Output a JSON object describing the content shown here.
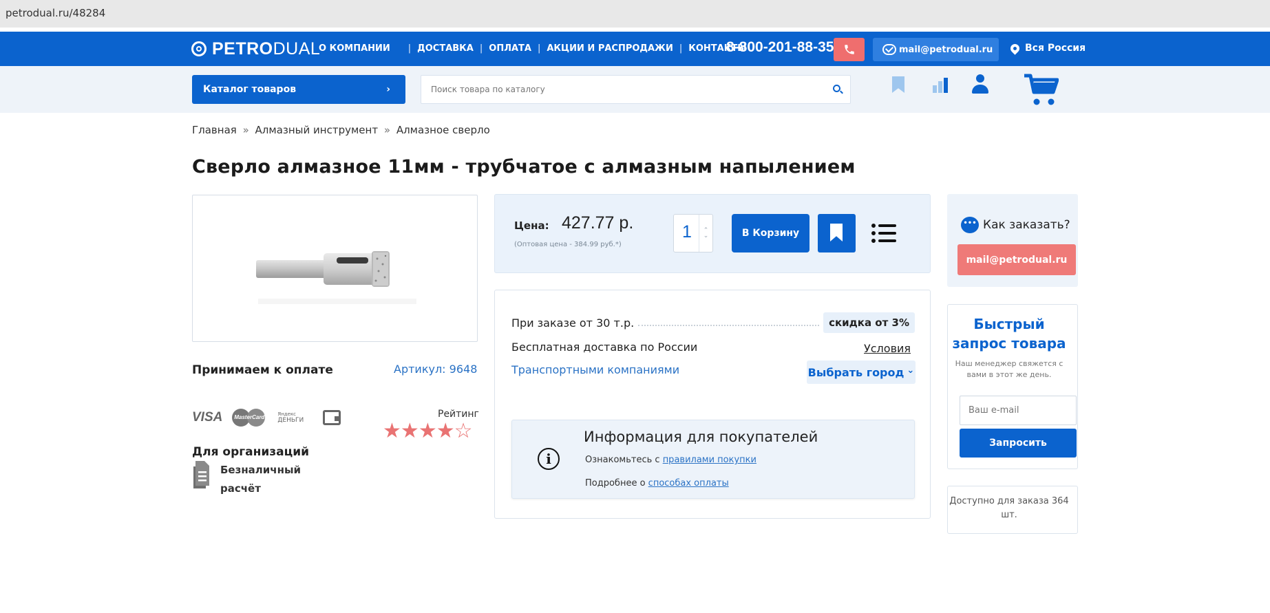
{
  "browser": {
    "url": "petrodual.ru/48284"
  },
  "header": {
    "logo_bold": "PETRO",
    "logo_light": "DUAL",
    "nav": [
      "О КОМПАНИИ",
      "ДОСТАВКА",
      "ОПЛАТА",
      "АКЦИИ И РАСПРОДАЖИ",
      "КОНТАКТЫ"
    ],
    "phone": "8-800-201-88-35",
    "email": "mail@petrodual.ru",
    "region": "Вся Россия"
  },
  "subbar": {
    "catalog_label": "Каталог товаров",
    "catalog_arrow": "›",
    "search_placeholder": "Поиск товара по каталогу"
  },
  "breadcrumb": {
    "items": [
      "Главная",
      "Алмазный инструмент",
      "Алмазное сверло"
    ],
    "separator": "»"
  },
  "product": {
    "title": "Сверло алмазное 11мм - трубчатое с алмазным напылением",
    "sku": "Артикул: 9648",
    "rating_label": "Рейтинг",
    "rating_value": 4,
    "rating_max": 5,
    "image_alt": "diamond-drill-bit"
  },
  "payment": {
    "title": "Принимаем к оплате",
    "visa": "VISA",
    "mastercard": "MasterCard",
    "yandex_small": "Яндекс",
    "yandex_big": "ДЕНЬГИ",
    "org_title": "Для организаций",
    "cashless": "Безналичный расчёт"
  },
  "price": {
    "label": "Цена:",
    "value": "427.77 р.",
    "wholesale": "(Оптовая цена - 384.99 руб.*)",
    "qty": "1",
    "cart_button": "В Корзину"
  },
  "terms": {
    "discount_label": "При заказе от 30 т.р.",
    "discount_value": "скидка от 3%",
    "free_delivery": "Бесплатная доставка по России",
    "conditions": "Условия",
    "transport": "Транспортными компаниями",
    "choose_city": "Выбрать город",
    "choose_city_arrow": "⌄"
  },
  "info": {
    "title": "Информация для покупателей",
    "line1_prefix": "Ознакомьтесь с",
    "line1_link": "правилами покупки",
    "line2_prefix": "Подробнее о",
    "line2_link": "способах оплаты"
  },
  "sidebar": {
    "how_to_order": "Как заказать?",
    "mail_button": "mail@petrodual.ru",
    "quick_title": "Быстрый запрос товара",
    "quick_sub": "Наш менеджер свяжется с вами в этот же день.",
    "email_placeholder": "Ваш e-mail",
    "request_button": "Запросить",
    "stock": "Доступно для заказа 364 шт."
  },
  "colors": {
    "brand_blue": "#0b63ce",
    "accent_red": "#ef6e6e",
    "link_blue": "#2a72c5"
  }
}
